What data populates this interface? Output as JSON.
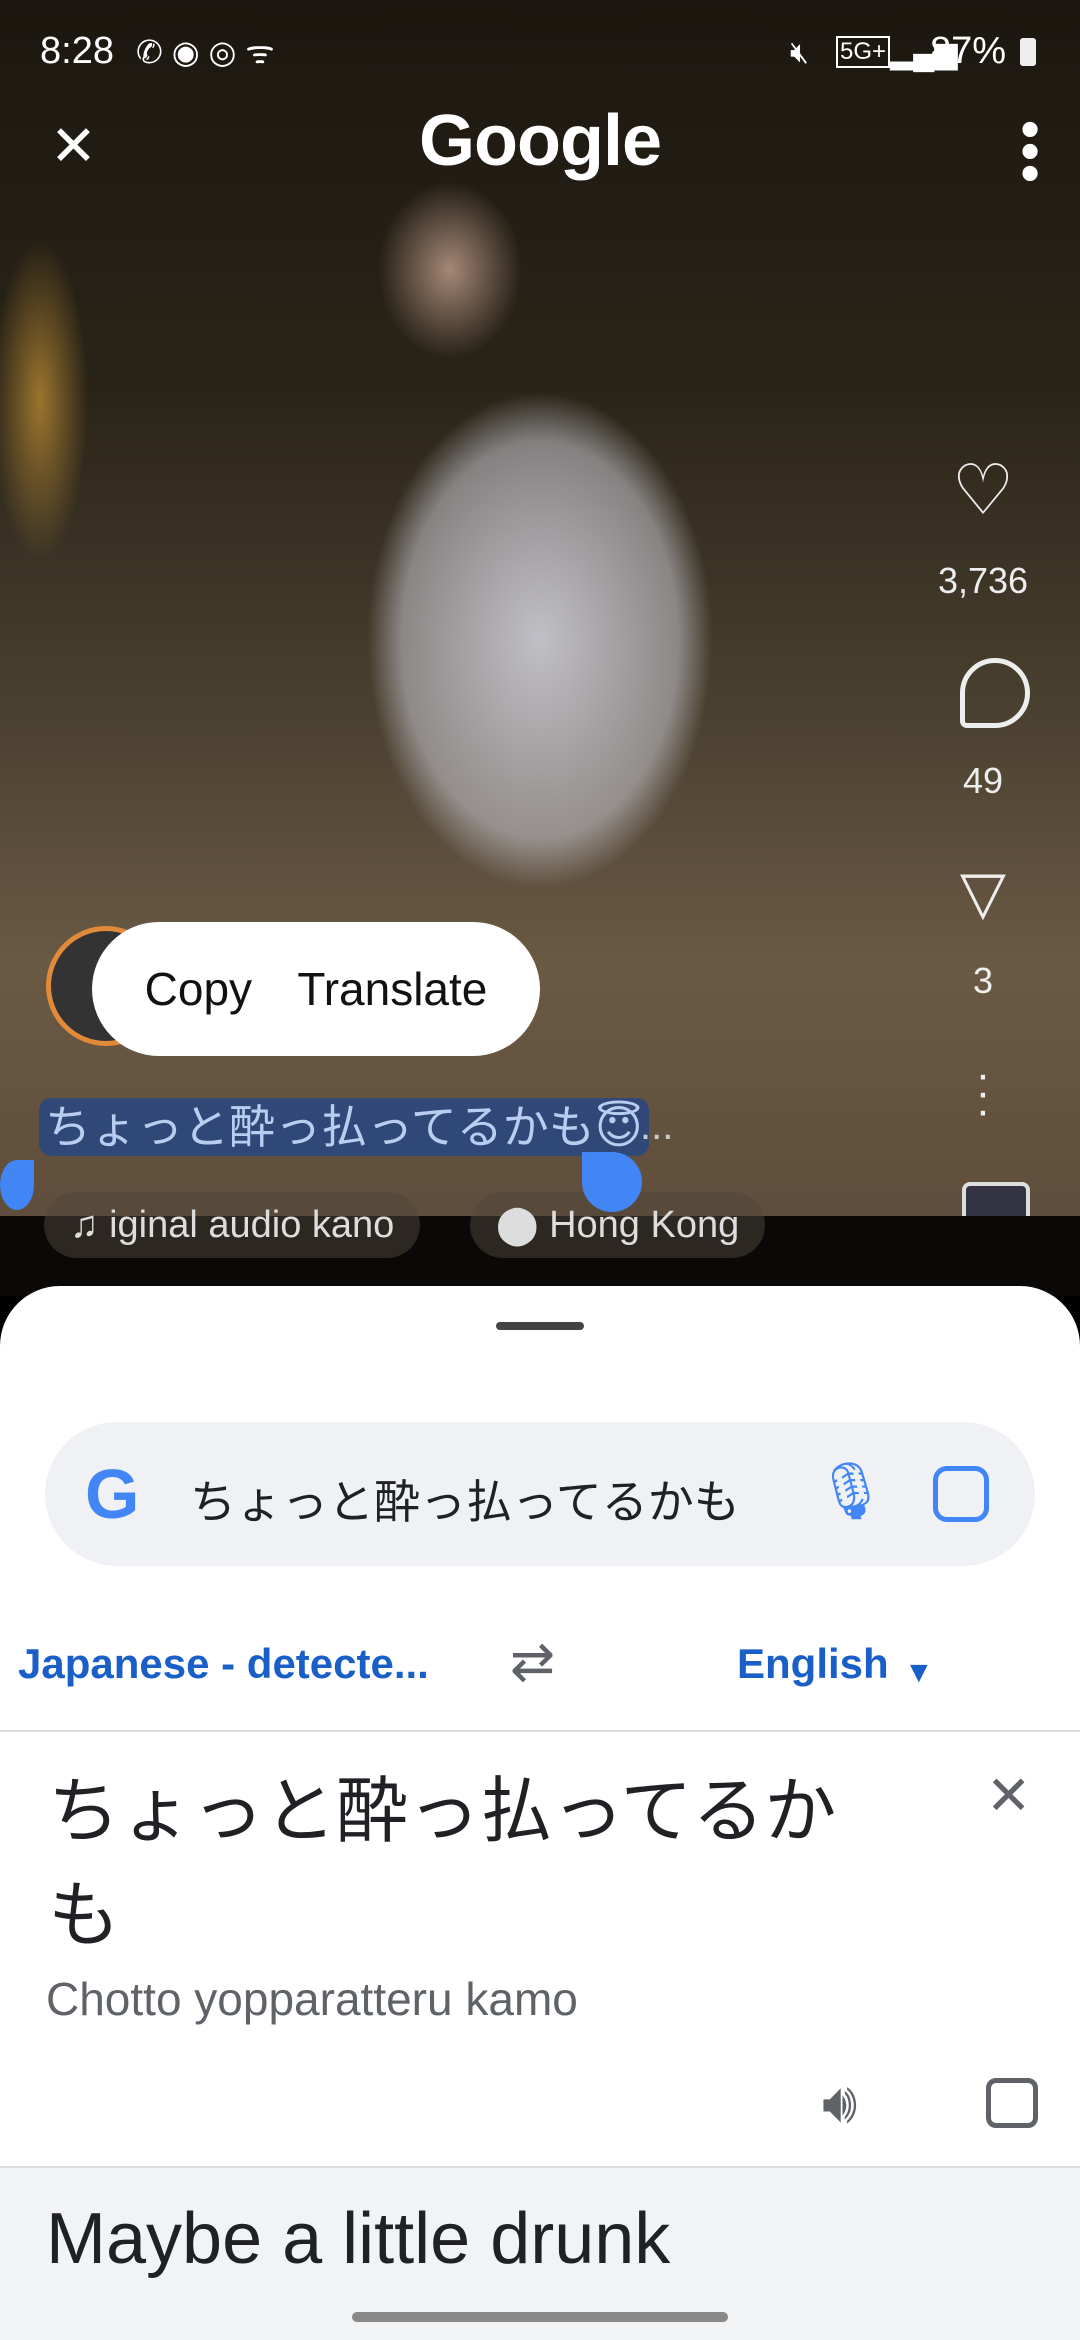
{
  "status_bar": {
    "time": "8:28",
    "battery": "87%",
    "network": "5G+"
  },
  "header": {
    "title": "Google"
  },
  "post": {
    "likes": "3,736",
    "comments": "49",
    "shares": "3",
    "caption": "ちょっと酔っ払ってるかも",
    "caption_emoji": "😇",
    "more": "...",
    "audio": "iginal audio   kano",
    "location": "Hong Kong"
  },
  "selection_menu": {
    "copy": "Copy",
    "translate": "Translate"
  },
  "search": {
    "query": "ちょっと酔っ払ってるかも"
  },
  "translate": {
    "source_lang": "Japanese - detecte...",
    "target_lang": "English",
    "source_text": "ちょっと酔っ払ってるかも",
    "romanization": "Chotto yopparatteru kamo",
    "translation": "Maybe a little drunk"
  },
  "colors": {
    "accent": "#1a5fc8",
    "selection": "#4285f4"
  }
}
